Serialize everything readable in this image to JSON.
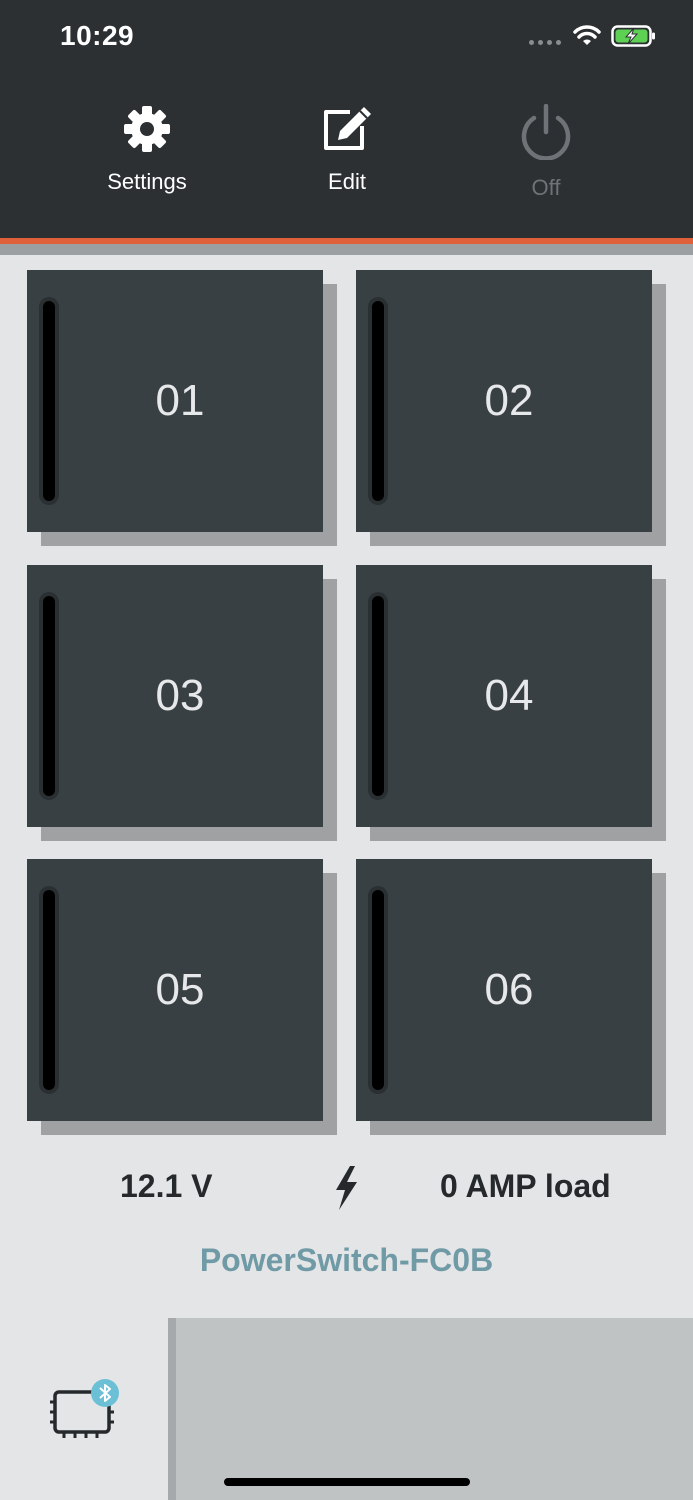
{
  "status_bar": {
    "time": "10:29"
  },
  "toolbar": {
    "settings_label": "Settings",
    "edit_label": "Edit",
    "power_label": "Off"
  },
  "channels": [
    {
      "label": "01"
    },
    {
      "label": "02"
    },
    {
      "label": "03"
    },
    {
      "label": "04"
    },
    {
      "label": "05"
    },
    {
      "label": "06"
    }
  ],
  "readings": {
    "voltage": "12.1 V",
    "load": "0 AMP load"
  },
  "device": {
    "name": "PowerSwitch-FC0B"
  },
  "colors": {
    "accent": "#e0603a",
    "device_name": "#6f9aa6",
    "bluetooth_badge": "#6cc0d6",
    "battery": "#5ed054"
  }
}
